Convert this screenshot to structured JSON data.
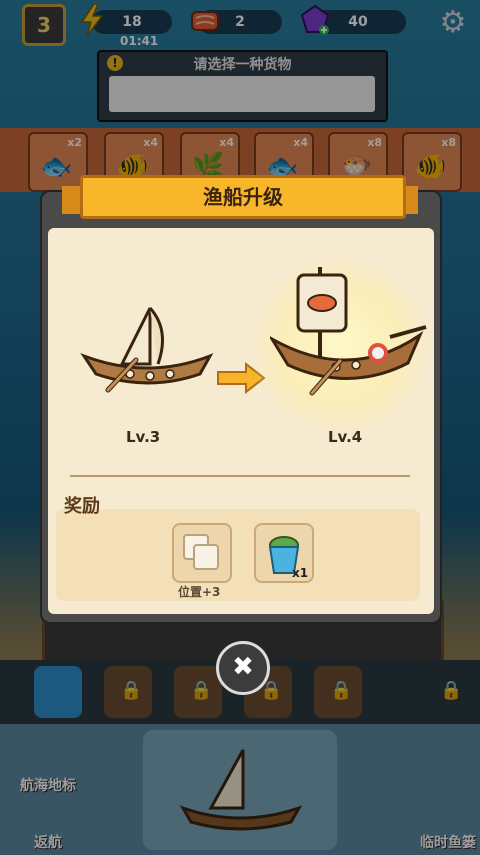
{
  "hud": {
    "level": "3",
    "energy": "18",
    "timer": "01:41",
    "fish": "2",
    "gems": "40"
  },
  "order": {
    "title": "请选择一种货物"
  },
  "goods": [
    {
      "mult": "x2"
    },
    {
      "mult": "x4"
    },
    {
      "mult": "x4"
    },
    {
      "mult": "x4"
    },
    {
      "mult": "x8"
    },
    {
      "mult": "x8"
    }
  ],
  "modal": {
    "title": "渔船升级",
    "from_level": "Lv.3",
    "to_level": "Lv.4",
    "reward_title": "奖励",
    "rewards": [
      {
        "label": "位置+3"
      },
      {
        "label": "x1"
      }
    ]
  },
  "bottom": {
    "left_label_top": "航海地标",
    "left_label_bottom": "返航",
    "right_label": "临时鱼篓"
  },
  "colors": {
    "banner": "#f8b62a",
    "panel": "#f6ead0",
    "accent_arrow": "#f7b42a"
  }
}
